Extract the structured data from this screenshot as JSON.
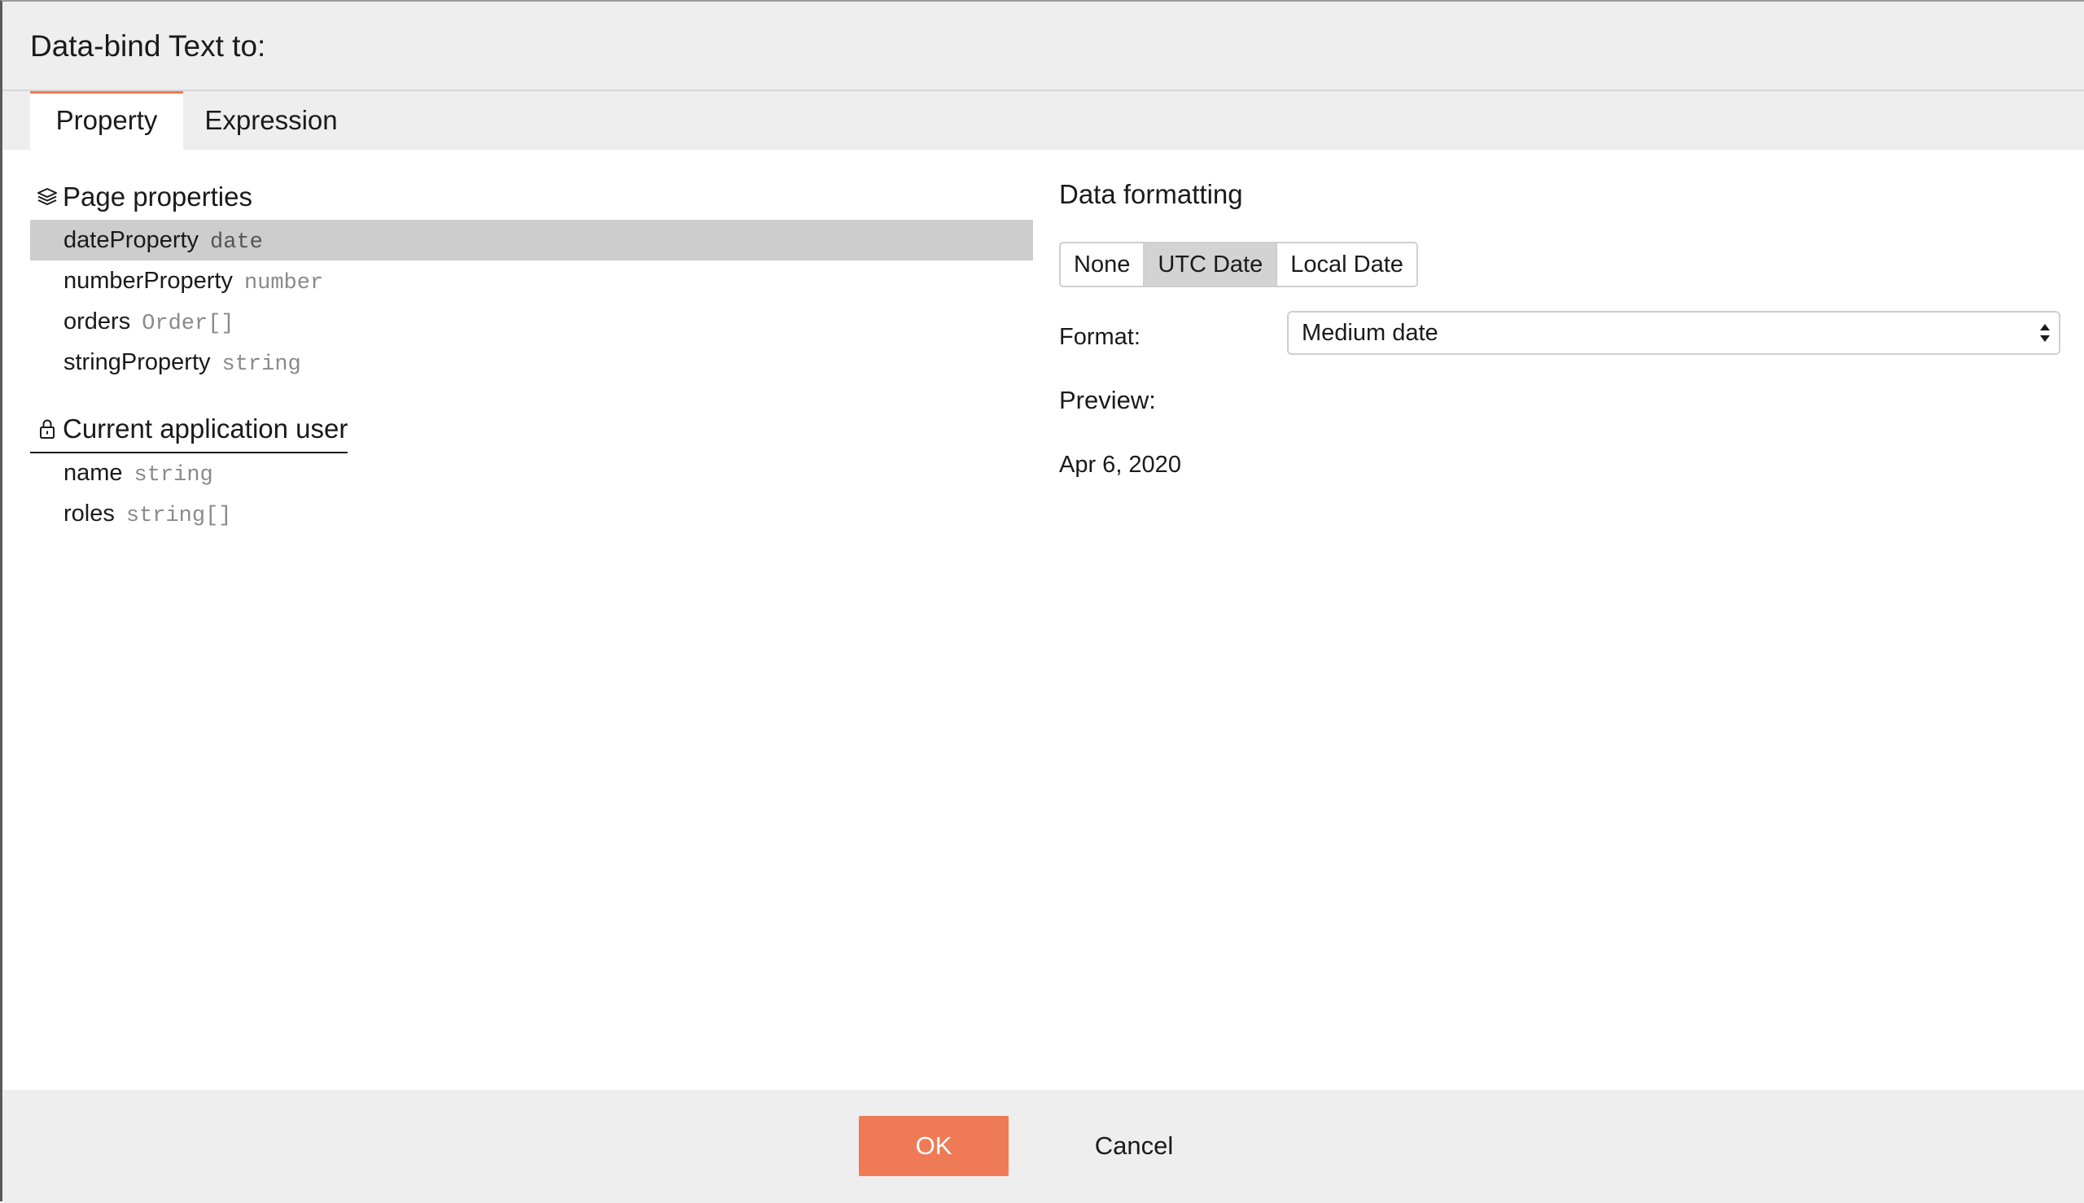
{
  "dialog": {
    "title": "Data-bind Text to:"
  },
  "tabs": [
    {
      "label": "Property",
      "active": true
    },
    {
      "label": "Expression",
      "active": false
    }
  ],
  "page_properties": {
    "heading": "Page properties",
    "icon": "layers-icon",
    "items": [
      {
        "name": "dateProperty",
        "type": "date",
        "selected": true
      },
      {
        "name": "numberProperty",
        "type": "number",
        "selected": false
      },
      {
        "name": "orders",
        "type": "Order[]",
        "selected": false
      },
      {
        "name": "stringProperty",
        "type": "string",
        "selected": false
      }
    ]
  },
  "current_user": {
    "heading": "Current application user",
    "icon": "lock-icon",
    "items": [
      {
        "name": "name",
        "type": "string"
      },
      {
        "name": "roles",
        "type": "string[]"
      }
    ]
  },
  "formatting": {
    "title": "Data formatting",
    "options": [
      "None",
      "UTC Date",
      "Local Date"
    ],
    "selected_option": "UTC Date",
    "format_label": "Format:",
    "format_value": "Medium date",
    "preview_label": "Preview:",
    "preview_value": "Apr 6, 2020"
  },
  "footer": {
    "ok_label": "OK",
    "cancel_label": "Cancel"
  },
  "colors": {
    "accent": "#ee7b55",
    "selected_row": "#cdcdcd",
    "chrome": "#eeeeee"
  }
}
